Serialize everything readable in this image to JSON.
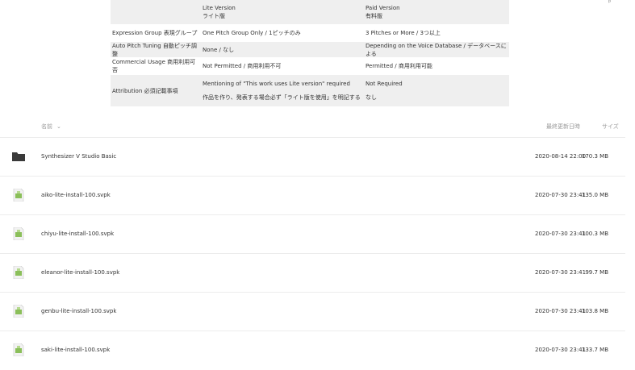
{
  "comparison": {
    "header": {
      "lite": [
        "Lite Version",
        "ライト版"
      ],
      "paid": [
        "Paid Version",
        "有料版"
      ]
    },
    "rows": [
      {
        "label": "Expression Group 表現グループ",
        "lite": "One Pitch Group Only / 1ピッチのみ",
        "paid": "3 Pitches or More / 3つ以上"
      },
      {
        "label": "Auto Pitch Tuning 自動ピッチ調整",
        "lite": "None / なし",
        "paid": "Depending on the Voice Database / データベースによる"
      },
      {
        "label": "Commercial Usage 商用利用可否",
        "lite": "Not Permitted / 商用利用不可",
        "paid": "Permitted / 商用利用可能"
      },
      {
        "label": "Attribution 必須記載事項",
        "lite_lines": [
          "Mentioning of \"This work uses Lite version\" required",
          "作品を作り、発表する場合必ず「ライト版を使用」を明記する"
        ],
        "paid_lines": [
          "Not Required",
          "なし"
        ]
      }
    ]
  },
  "list": {
    "columns": {
      "name": "名前",
      "modified": "最終更新日時",
      "size": "サイズ"
    },
    "files": [
      {
        "icon": "folder-icon",
        "name": "Synthesizer V Studio Basic",
        "date": "2020-08-14 22:00",
        "size": "170.3 MB"
      },
      {
        "icon": "file-icon",
        "name": "aiko-lite-install-100.svpk",
        "date": "2020-07-30 23:41",
        "size": "135.0 MB"
      },
      {
        "icon": "file-icon",
        "name": "chiyu-lite-install-100.svpk",
        "date": "2020-07-30 23:41",
        "size": "100.3 MB"
      },
      {
        "icon": "file-icon",
        "name": "eleanor-lite-install-100.svpk",
        "date": "2020-07-30 23:41",
        "size": "99.7 MB"
      },
      {
        "icon": "file-icon",
        "name": "genbu-lite-install-100.svpk",
        "date": "2020-07-30 23:41",
        "size": "103.8 MB"
      },
      {
        "icon": "file-icon",
        "name": "saki-lite-install-100.svpk",
        "date": "2020-07-30 23:41",
        "size": "133.7 MB"
      }
    ]
  }
}
